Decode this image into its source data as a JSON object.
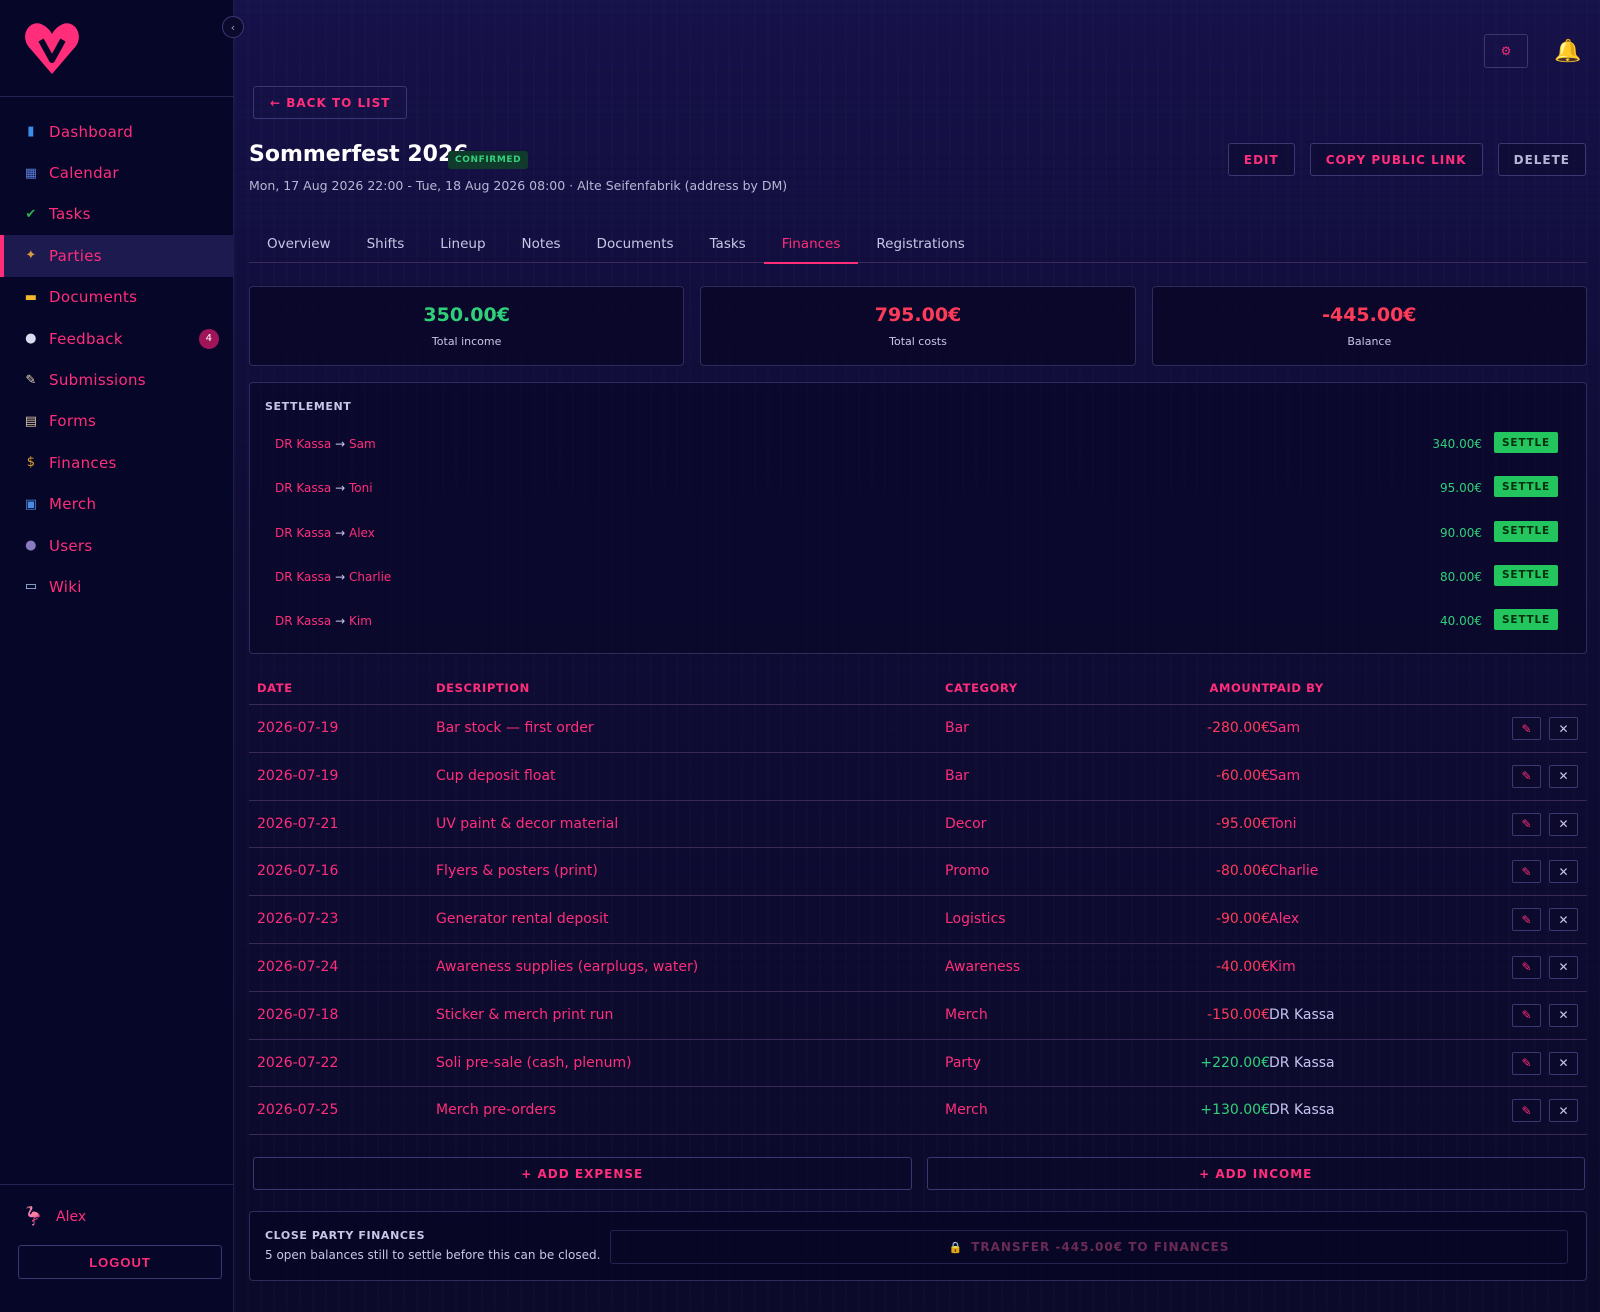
{
  "sidebar": {
    "items": [
      {
        "label": "Dashboard",
        "icon": "bar-chart-icon",
        "glyph": "▮",
        "color": "#3a8ee8"
      },
      {
        "label": "Calendar",
        "icon": "calendar-icon",
        "glyph": "▦",
        "color": "#5a7ad8"
      },
      {
        "label": "Tasks",
        "icon": "checkbox-icon",
        "glyph": "✔",
        "color": "#2fb04a"
      },
      {
        "label": "Parties",
        "icon": "party-popper-icon",
        "glyph": "✦",
        "color": "#d89a3a"
      },
      {
        "label": "Documents",
        "icon": "folder-icon",
        "glyph": "▬",
        "color": "#f2b92e"
      },
      {
        "label": "Feedback",
        "icon": "speech-bubble-icon",
        "glyph": "●",
        "color": "#d8dcf0",
        "badge": "4"
      },
      {
        "label": "Submissions",
        "icon": "memo-icon",
        "glyph": "✎",
        "color": "#e6d6b8"
      },
      {
        "label": "Forms",
        "icon": "clipboard-icon",
        "glyph": "▤",
        "color": "#d8c2a0"
      },
      {
        "label": "Finances",
        "icon": "money-bag-icon",
        "glyph": "$",
        "color": "#e0a030"
      },
      {
        "label": "Merch",
        "icon": "shopping-bags-icon",
        "glyph": "▣",
        "color": "#4a8ae0"
      },
      {
        "label": "Users",
        "icon": "users-icon",
        "glyph": "●",
        "color": "#8a7ac0"
      },
      {
        "label": "Wiki",
        "icon": "book-icon",
        "glyph": "▭",
        "color": "#a8c8f0"
      }
    ],
    "active_index": 3,
    "user": {
      "name": "Alex",
      "avatar_glyph": "🦩"
    },
    "logout_label": "LOGOUT"
  },
  "header": {
    "back_label": "← BACK TO LIST",
    "title": "Sommerfest 2026",
    "status": "CONFIRMED",
    "subtitle": "Mon, 17 Aug 2026 22:00 - Tue, 18 Aug 2026 08:00 · Alte Seifenfabrik (address by DM)",
    "actions": {
      "edit": "EDIT",
      "copy_link": "COPY PUBLIC LINK",
      "delete": "DELETE"
    },
    "settings_glyph": "⚙",
    "bell_glyph": "🔔"
  },
  "tabs": [
    "Overview",
    "Shifts",
    "Lineup",
    "Notes",
    "Documents",
    "Tasks",
    "Finances",
    "Registrations"
  ],
  "active_tab": 6,
  "stats": {
    "income": {
      "value": "350.00€",
      "label": "Total income"
    },
    "costs": {
      "value": "795.00€",
      "label": "Total costs"
    },
    "balance": {
      "value": "-445.00€",
      "label": "Balance"
    }
  },
  "settlement": {
    "title": "SETTLEMENT",
    "button_label": "SETTLE",
    "rows": [
      {
        "from": "DR Kassa",
        "arrow": "→",
        "to": "Sam",
        "amount": "340.00€"
      },
      {
        "from": "DR Kassa",
        "arrow": "→",
        "to": "Toni",
        "amount": "95.00€"
      },
      {
        "from": "DR Kassa",
        "arrow": "→",
        "to": "Alex",
        "amount": "90.00€"
      },
      {
        "from": "DR Kassa",
        "arrow": "→",
        "to": "Charlie",
        "amount": "80.00€"
      },
      {
        "from": "DR Kassa",
        "arrow": "→",
        "to": "Kim",
        "amount": "40.00€"
      }
    ]
  },
  "table": {
    "headers": {
      "date": "DATE",
      "description": "DESCRIPTION",
      "category": "CATEGORY",
      "amount": "AMOUNT",
      "paid_by": "PAID BY"
    },
    "rows": [
      {
        "date": "2026-07-19",
        "description": "Bar stock — first order",
        "category": "Bar",
        "amount": "-280.00€",
        "paid_by": "Sam",
        "income": false
      },
      {
        "date": "2026-07-19",
        "description": "Cup deposit float",
        "category": "Bar",
        "amount": "-60.00€",
        "paid_by": "Sam",
        "income": false
      },
      {
        "date": "2026-07-21",
        "description": "UV paint & decor material",
        "category": "Decor",
        "amount": "-95.00€",
        "paid_by": "Toni",
        "income": false
      },
      {
        "date": "2026-07-16",
        "description": "Flyers & posters (print)",
        "category": "Promo",
        "amount": "-80.00€",
        "paid_by": "Charlie",
        "income": false
      },
      {
        "date": "2026-07-23",
        "description": "Generator rental deposit",
        "category": "Logistics",
        "amount": "-90.00€",
        "paid_by": "Alex",
        "income": false
      },
      {
        "date": "2026-07-24",
        "description": "Awareness supplies (earplugs, water)",
        "category": "Awareness",
        "amount": "-40.00€",
        "paid_by": "Kim",
        "income": false
      },
      {
        "date": "2026-07-18",
        "description": "Sticker & merch print run",
        "category": "Merch",
        "amount": "-150.00€",
        "paid_by": "DR Kassa",
        "income": false
      },
      {
        "date": "2026-07-22",
        "description": "Soli pre-sale (cash, plenum)",
        "category": "Party",
        "amount": "+220.00€",
        "paid_by": "DR Kassa",
        "income": true
      },
      {
        "date": "2026-07-25",
        "description": "Merch pre-orders",
        "category": "Merch",
        "amount": "+130.00€",
        "paid_by": "DR Kassa",
        "income": true
      }
    ],
    "edit_glyph": "✎",
    "delete_glyph": "✕"
  },
  "add": {
    "expense": "+ ADD EXPENSE",
    "income": "+ ADD INCOME"
  },
  "close": {
    "title": "CLOSE PARTY FINANCES",
    "text": "5 open balances still to settle before this can be closed.",
    "transfer_label": "TRANSFER -445.00€ TO FINANCES",
    "lock_glyph": "🔒"
  }
}
